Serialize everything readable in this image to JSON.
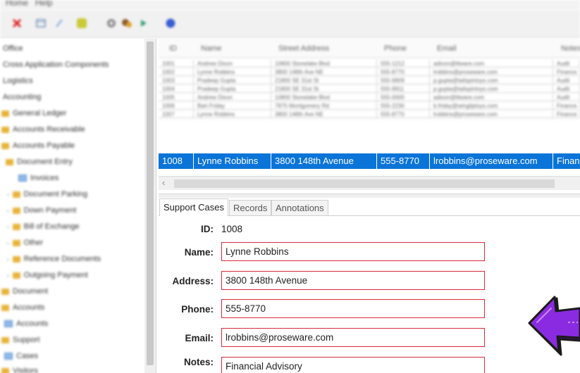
{
  "menu": {
    "items": [
      "Home",
      "Help"
    ]
  },
  "toolbar": {
    "icons": [
      "close-icon",
      "save-icon",
      "edit-icon",
      "note-icon",
      "settings-icon",
      "palette-icon",
      "run-icon",
      "info-icon"
    ]
  },
  "tree": {
    "items": [
      {
        "label": "Office"
      },
      {
        "label": "Cross Application Components"
      },
      {
        "label": "Logistics"
      },
      {
        "label": "Accounting"
      },
      {
        "label": "General Ledger"
      },
      {
        "label": "Accounts Receivable"
      },
      {
        "label": "Accounts Payable"
      },
      {
        "label": "Document Entry"
      },
      {
        "label": "Invoices"
      },
      {
        "label": "Document Parking"
      },
      {
        "label": "Down Payment"
      },
      {
        "label": "Bill of Exchange"
      },
      {
        "label": "Other"
      },
      {
        "label": "Reference Documents"
      },
      {
        "label": "Outgoing Payment"
      },
      {
        "label": "Document"
      },
      {
        "label": "Accounts"
      },
      {
        "label": "Accounts"
      },
      {
        "label": "Support"
      },
      {
        "label": "Cases"
      },
      {
        "label": "Visitors"
      }
    ]
  },
  "grid": {
    "columns": [
      "ID",
      "Name",
      "Street Address",
      "Phone",
      "Email",
      "Notes"
    ],
    "rows": [
      [
        "1001",
        "Andrew Dixon",
        "10800 Stonelake Blvd",
        "555-1212",
        "adixon@litware.com",
        "Audit"
      ],
      [
        "1002",
        "Lynne Robbins",
        "3800 148th Ave NE",
        "555-8770",
        "lrobbins@proseware.com",
        "Finance"
      ],
      [
        "1003",
        "Pradeep Gupta",
        "21800 SE 31st St",
        "555-9909",
        "p.gupta@tailspintoys.com",
        "Audit"
      ],
      [
        "1004",
        "Pradeep Gupta",
        "21800 SE 31st St",
        "555-9911",
        "p.gupta@tailspintoys.com",
        "Audit"
      ],
      [
        "1005",
        "Andrew Dixon",
        "10800 Stonelake Blvd",
        "555-0000",
        "adixon@litware.com",
        "Audit"
      ],
      [
        "1006",
        "Bart Friday",
        "7875 Montgomery Rd",
        "555-2230",
        "b.friday@wingtiptoys.com",
        "Finance"
      ],
      [
        "1007",
        "Lynne Robbins",
        "3800 148th Ave NE",
        "555-8770",
        "lrobbins@proseware.com",
        "Finance"
      ]
    ],
    "selected": [
      "1008",
      "Lynne Robbins",
      "3800 148th Avenue",
      "555-8770",
      "lrobbins@proseware.com",
      "Financial Advisory"
    ],
    "scroll_left_glyph": "‹"
  },
  "tabs": [
    {
      "label": "Support Cases",
      "active": true
    },
    {
      "label": "Records",
      "active": false
    },
    {
      "label": "Annotations",
      "active": false
    }
  ],
  "form": {
    "id_label": "ID:",
    "id_value": "1008",
    "name_label": "Name:",
    "name_value": "Lynne Robbins",
    "address_label": "Address:",
    "address_value": "3800 148th Avenue",
    "phone_label": "Phone:",
    "phone_value": "555-8770",
    "email_label": "Email:",
    "email_value": "lrobbins@proseware.com",
    "notes_label": "Notes:",
    "notes_value": "Financial Advisory"
  },
  "colors": {
    "selection": "#0a74d8",
    "field_border": "#d92a3a",
    "arrow_fill": "#8a2be2",
    "arrow_stroke": "#1a1a1a"
  }
}
